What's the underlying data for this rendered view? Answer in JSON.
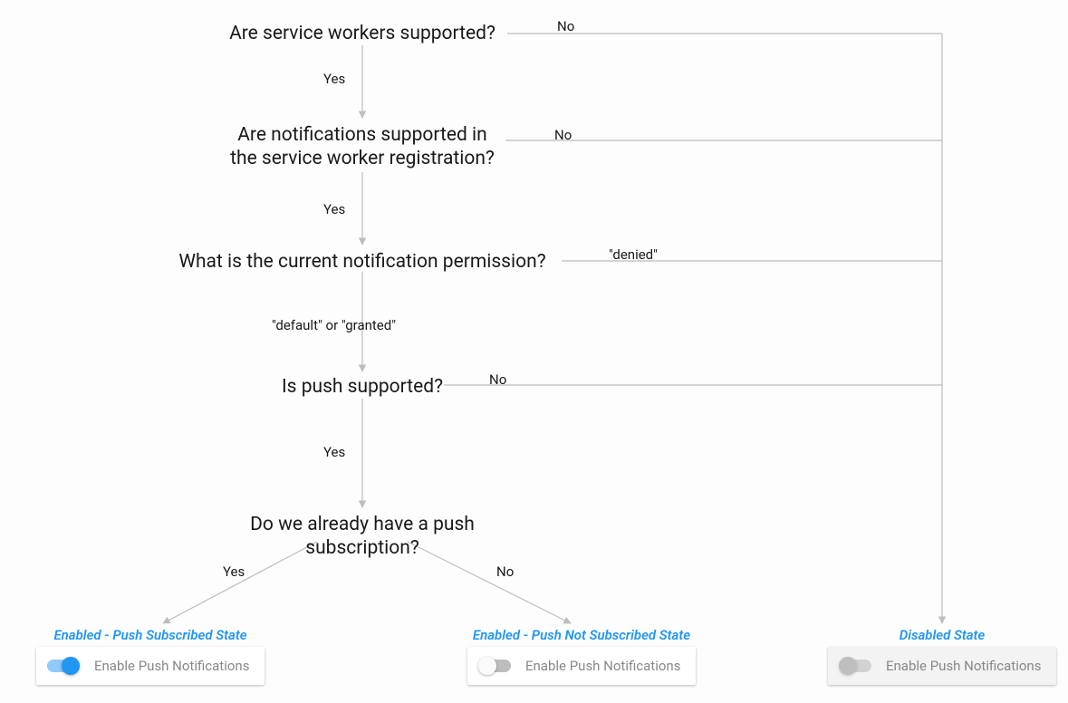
{
  "nodes": {
    "q1": "Are service workers supported?",
    "q2_line1": "Are notifications supported in",
    "q2_line2": "the service worker registration?",
    "q3": "What is the current notification permission?",
    "q4": "Is push supported?",
    "q5": "Do we already have a push subscription?"
  },
  "edges": {
    "yes": "Yes",
    "no": "No",
    "denied": "\"denied\"",
    "default_or_granted": "\"default\" or \"granted\""
  },
  "states": {
    "subscribed": {
      "title": "Enabled - Push Subscribed State",
      "label": "Enable Push Notifications"
    },
    "not_subscribed": {
      "title": "Enabled - Push Not Subscribed State",
      "label": "Enable Push Notifications"
    },
    "disabled": {
      "title": "Disabled State",
      "label": "Enable Push Notifications"
    }
  }
}
